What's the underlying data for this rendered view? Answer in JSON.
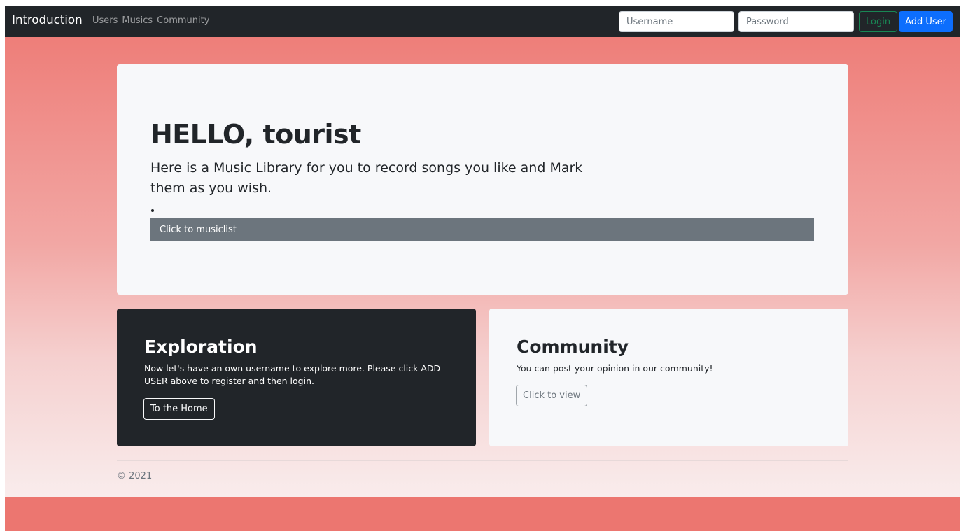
{
  "navbar": {
    "brand": "Introduction",
    "links": [
      "Users",
      "Musics",
      "Community"
    ],
    "username_placeholder": "Username",
    "password_placeholder": "Password",
    "login_label": "Login",
    "add_user_label": "Add User"
  },
  "hero": {
    "title": "HELLO, tourist",
    "lead": "Here is a Music Library for you to record songs you like and Mark them as you wish.",
    "button_label": "Click to musiclist"
  },
  "exploration": {
    "title": "Exploration",
    "text": "Now let's have an own username to explore more. Please click ADD USER above to register and then login.",
    "button_label": "To the Home"
  },
  "community": {
    "title": "Community",
    "text": "You can post your opinion in our community!",
    "button_label": "Click to view"
  },
  "footer": {
    "copyright": "© 2021"
  },
  "colors": {
    "navbar_bg": "#212529",
    "gradient_top": "#ee7e79",
    "gradient_bottom": "#f9ecec",
    "bottom_band": "#ec7670",
    "primary": "#0d6efd",
    "success": "#198754",
    "secondary": "#6c757d"
  }
}
